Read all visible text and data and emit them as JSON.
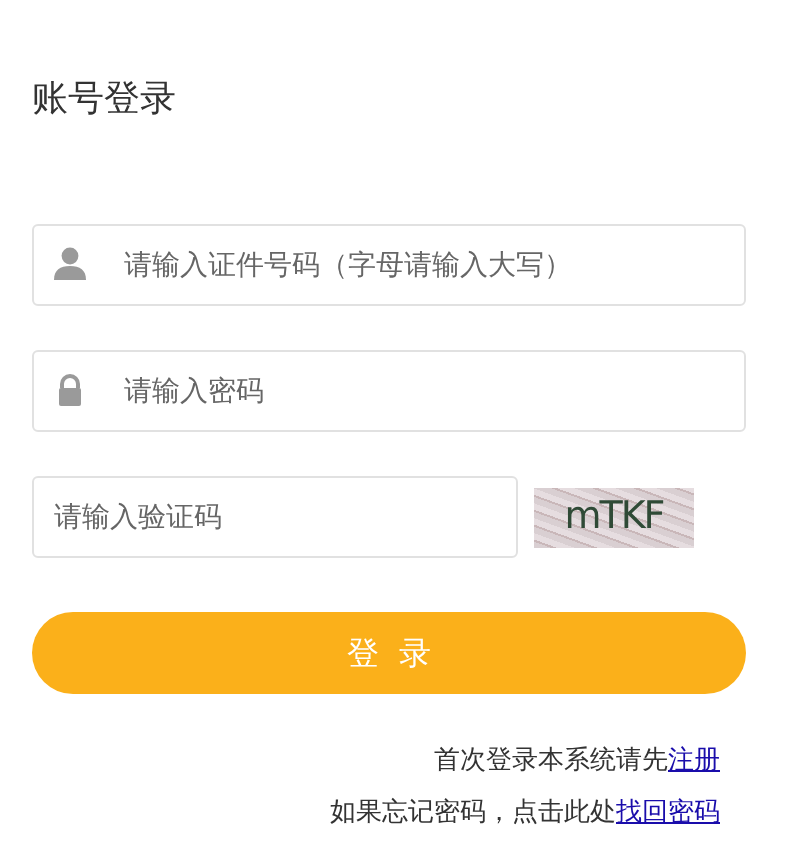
{
  "title": "账号登录",
  "fields": [
    {
      "kind": "user",
      "placeholder": "请输入证件号码（字母请输入大写）"
    },
    {
      "kind": "password",
      "placeholder": "请输入密码"
    },
    {
      "kind": "captcha",
      "placeholder": "请输入验证码",
      "captcha": "mTKF"
    }
  ],
  "login_button": "登  录",
  "notes": [
    {
      "text": "首次登录本系统请先",
      "link": "注册"
    },
    {
      "text": "如果忘记密码，点击此处",
      "link": "找回密码"
    }
  ]
}
